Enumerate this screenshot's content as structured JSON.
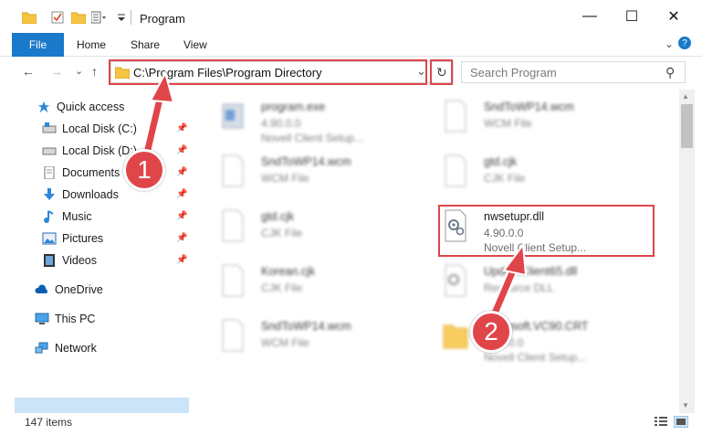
{
  "window": {
    "title": "Program",
    "minimize_glyph": "—",
    "maximize_glyph": "☐",
    "close_glyph": "✕"
  },
  "ribbon": {
    "tabs": [
      "File",
      "Home",
      "Share",
      "View"
    ],
    "expand_glyph": "⌄",
    "help_glyph": "?"
  },
  "nav": {
    "back_glyph": "←",
    "forward_glyph": "→",
    "recent_glyph": "⌄",
    "up_glyph": "↑",
    "address": "C:\\Program Files\\Program Directory",
    "dropdown_glyph": "⌄",
    "refresh_glyph": "↻",
    "search_placeholder": "Search Program",
    "search_glyph": "⚲"
  },
  "sidebar": {
    "items": [
      {
        "label": "Quick access",
        "icon": "star-icon",
        "pinned": false
      },
      {
        "label": "Local Disk (C:)",
        "icon": "drive-icon",
        "pinned": true
      },
      {
        "label": "Local Disk (D:)",
        "icon": "drive-icon",
        "pinned": true
      },
      {
        "label": "Documents",
        "icon": "documents-icon",
        "pinned": true
      },
      {
        "label": "Downloads",
        "icon": "download-icon",
        "pinned": true
      },
      {
        "label": "Music",
        "icon": "music-icon",
        "pinned": true
      },
      {
        "label": "Pictures",
        "icon": "pictures-icon",
        "pinned": true
      },
      {
        "label": "Videos",
        "icon": "videos-icon",
        "pinned": true
      },
      {
        "label": "OneDrive",
        "icon": "cloud-icon",
        "pinned": false
      },
      {
        "label": "This PC",
        "icon": "computer-icon",
        "pinned": false,
        "selected": true
      },
      {
        "label": "Network",
        "icon": "network-icon",
        "pinned": false
      }
    ]
  },
  "files": [
    {
      "name": "program.exe",
      "line2": "4.90.0.0",
      "line3": "Novell Client Setup...",
      "icon": "exe-icon",
      "blurred": true
    },
    {
      "name": "SndToWP14.wcm",
      "line2": "WCM File",
      "line3": "",
      "icon": "file-icon",
      "blurred": true
    },
    {
      "name": "SndToWP14.wcm",
      "line2": "WCM File",
      "line3": "",
      "icon": "file-icon",
      "blurred": true
    },
    {
      "name": "gtd.cjk",
      "line2": "CJK File",
      "line3": "",
      "icon": "file-icon",
      "blurred": true
    },
    {
      "name": "gtd.cjk",
      "line2": "CJK File",
      "line3": "",
      "icon": "file-icon",
      "blurred": true
    },
    {
      "name": "nwsetupr.dll",
      "line2": "4.90.0.0",
      "line3": "Novell Client Setup...",
      "icon": "dll-gear-icon",
      "blurred": false
    },
    {
      "name": "Korean.cjk",
      "line2": "CJK File",
      "line3": "",
      "icon": "file-icon",
      "blurred": true
    },
    {
      "name": "UpdateClient65.dll",
      "line2": "Resource DLL",
      "line3": "",
      "icon": "dll-gear-icon",
      "blurred": true
    },
    {
      "name": "SndToWP14.wcm",
      "line2": "WCM File",
      "line3": "",
      "icon": "file-icon",
      "blurred": true
    },
    {
      "name": "Microsoft.VC90.CRT",
      "line2": "4.90.0.0",
      "line3": "Novell Client Setup...",
      "icon": "folder-icon",
      "blurred": true
    }
  ],
  "status": {
    "item_count": "147 items"
  },
  "callouts": [
    "1",
    "2"
  ],
  "colors": {
    "accent": "#1979ca",
    "highlight": "#e0454a",
    "selection": "#cce4f7"
  }
}
